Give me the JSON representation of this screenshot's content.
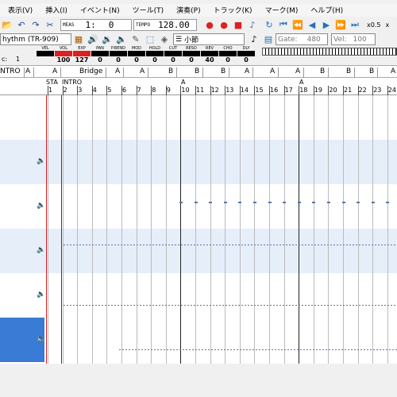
{
  "menu": [
    "表示(V)",
    "挿入(I)",
    "イベント(N)",
    "ツール(T)",
    "演奏(P)",
    "トラック(K)",
    "マーク(M)",
    "ヘルプ(H)"
  ],
  "transport": {
    "meas_label": "MEAS",
    "meas_value": "1:",
    "beat_value": "0",
    "tempo_label": "TEMPO",
    "tempo_value": "128.00",
    "zoom_x": "x0.5",
    "zoom_x2": "x"
  },
  "toolbar2": {
    "instrument": "hythm (TR-909)",
    "unit": "小節",
    "gate_label": "Gate:",
    "gate_value": "480",
    "vel_label": "Vel:",
    "vel_value": "100"
  },
  "mixer": {
    "channel_label": "c:",
    "channel_value": "1",
    "labels": [
      "VEL",
      "VOL",
      "EXP",
      "PAN",
      "P.BEND",
      "MOD",
      "HOLD",
      "CUT",
      "RESO",
      "REV",
      "CHO",
      "DLY"
    ],
    "values": [
      "",
      "100",
      "127",
      "0",
      "0",
      "0",
      "0",
      "0",
      "0",
      "40",
      "0",
      "0"
    ]
  },
  "markers": [
    "NTRO",
    "A",
    "A",
    "Bridge",
    "A",
    "A",
    "B",
    "B",
    "B",
    "A",
    "A",
    "A",
    "B",
    "B",
    "B",
    "A"
  ],
  "measure_labels": {
    "a": "STA",
    "b": "INTRO",
    "c": "A",
    "d": "A"
  },
  "measures": [
    "1",
    "2",
    "3",
    "4",
    "5",
    "6",
    "7",
    "8",
    "9",
    "10",
    "11",
    "12",
    "13",
    "14",
    "15",
    "16",
    "17",
    "18",
    "19",
    "20",
    "21",
    "22",
    "23",
    "24"
  ],
  "colors": {
    "accent": "#3a7bd5",
    "row_alt": "#e6eef9",
    "selected": "#3a7bd5",
    "start_line": "#cc2222",
    "end_line": "#3333aa"
  }
}
